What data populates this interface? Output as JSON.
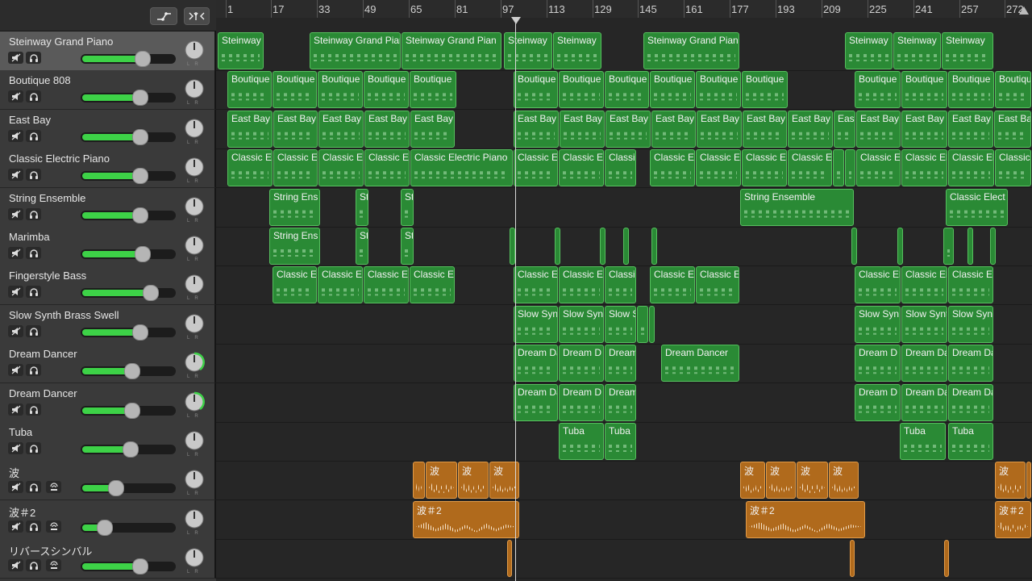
{
  "header": {
    "automation_icon": "automation-curve-icon",
    "filter_icon": "catch-filter-icon"
  },
  "ruler": {
    "bars": [
      "1",
      "17",
      "33",
      "49",
      "65",
      "81",
      "97",
      "113",
      "129",
      "145",
      "161",
      "177",
      "193",
      "209",
      "225",
      "241",
      "257",
      "272"
    ]
  },
  "colors": {
    "midi_region": "#2a8a35",
    "audio_region": "#b06a1c",
    "volume_meter": "#3dd247"
  },
  "tracks": [
    {
      "name": "Steinway Grand Piano",
      "selected": true,
      "volume": 0.75,
      "loop_button": false,
      "regions": [
        [
          "Steinway",
          2,
          60
        ],
        [
          "Steinway Grand Pian",
          116,
          230
        ],
        [
          "Steinway Grand Pian",
          230,
          355
        ],
        [
          "Steinway",
          357,
          418
        ],
        [
          "Steinway",
          418,
          479
        ],
        [
          "Steinway Grand Pian",
          530,
          650
        ],
        [
          "Steinway",
          780,
          840
        ],
        [
          "Steinway",
          840,
          900
        ],
        [
          "Steinway",
          900,
          965
        ]
      ]
    },
    {
      "name": "Boutique 808",
      "selected": false,
      "volume": 0.72,
      "loop_button": false,
      "regions": [
        [
          "Boutique",
          14,
          70
        ],
        [
          "Boutique",
          70,
          126
        ],
        [
          "Boutique",
          126,
          183
        ],
        [
          "Boutique",
          183,
          240
        ],
        [
          "Boutique",
          240,
          299
        ],
        [
          "Boutique",
          369,
          425
        ],
        [
          "Boutique",
          425,
          482
        ],
        [
          "Boutique",
          482,
          538
        ],
        [
          "Boutique",
          538,
          595
        ],
        [
          "Boutique",
          595,
          652
        ],
        [
          "Boutique",
          652,
          710
        ],
        [
          "Boutique",
          792,
          850
        ],
        [
          "Boutique",
          850,
          908
        ],
        [
          "Boutique",
          908,
          966
        ],
        [
          "Boutique",
          966,
          1012
        ]
      ]
    },
    {
      "name": "East Bay",
      "selected": false,
      "volume": 0.72,
      "loop_button": false,
      "regions": [
        [
          "East Bay",
          14,
          71
        ],
        [
          "East Bay",
          71,
          127
        ],
        [
          "East Bay",
          127,
          184
        ],
        [
          "East Bay",
          184,
          241
        ],
        [
          "East Bay",
          241,
          297
        ],
        [
          "East Bay",
          369,
          426
        ],
        [
          "East Bay",
          426,
          483
        ],
        [
          "East Bay",
          483,
          540
        ],
        [
          "East Bay",
          540,
          596
        ],
        [
          "East Bay",
          596,
          653
        ],
        [
          "East Bay",
          653,
          709
        ],
        [
          "East Bay",
          709,
          766
        ],
        [
          "East",
          766,
          794
        ],
        [
          "East Bay",
          794,
          850
        ],
        [
          "East Bay",
          850,
          908
        ],
        [
          "East Bay",
          908,
          965
        ],
        [
          "East Bay",
          965,
          1012
        ]
      ]
    },
    {
      "name": "Classic Electric Piano",
      "selected": false,
      "volume": 0.72,
      "loop_button": false,
      "regions": [
        [
          "Classic El",
          14,
          71
        ],
        [
          "Classic El",
          71,
          127
        ],
        [
          "Classic El",
          127,
          184
        ],
        [
          "Classic El",
          184,
          241
        ],
        [
          "Classic Electric Piano",
          241,
          369
        ],
        [
          "Classic El",
          369,
          425
        ],
        [
          "Classic El",
          425,
          482
        ],
        [
          "Classic",
          482,
          522
        ],
        [
          "Classic El",
          538,
          595
        ],
        [
          "Classic El",
          595,
          652
        ],
        [
          "Classic El",
          652,
          709
        ],
        [
          "Classic El",
          709,
          765
        ],
        [
          "",
          765,
          780
        ],
        [
          "",
          780,
          794
        ],
        [
          "Classic El",
          794,
          850
        ],
        [
          "Classic El",
          850,
          908
        ],
        [
          "Classic El",
          908,
          966
        ],
        [
          "Classic",
          966,
          1012
        ]
      ]
    },
    {
      "name": "String Ensemble",
      "selected": false,
      "volume": 0.72,
      "loop_button": false,
      "regions": [
        [
          "String Ens",
          66,
          130
        ],
        [
          "St",
          173,
          190
        ],
        [
          "St",
          229,
          246
        ],
        [
          "String Ensemble",
          650,
          792
        ],
        [
          "Classic Elect",
          905,
          983
        ]
      ]
    },
    {
      "name": "Marimba",
      "selected": false,
      "volume": 0.75,
      "loop_button": false,
      "regions": [
        [
          "String Ens",
          66,
          130
        ],
        [
          "St",
          173,
          190
        ],
        [
          "St",
          229,
          246
        ],
        [
          "",
          364,
          372
        ],
        [
          "",
          420,
          428
        ],
        [
          "",
          476,
          484
        ],
        [
          "",
          505,
          513
        ],
        [
          "",
          540,
          548
        ],
        [
          "",
          788,
          796
        ],
        [
          "",
          845,
          853
        ],
        [
          "",
          902,
          916
        ],
        [
          "",
          932,
          940
        ],
        [
          "",
          960,
          968
        ]
      ]
    },
    {
      "name": "Fingerstyle Bass",
      "selected": false,
      "volume": 0.85,
      "loop_button": false,
      "regions": [
        [
          "Classic El",
          70,
          126
        ],
        [
          "Classic El",
          126,
          183
        ],
        [
          "Classic El",
          183,
          240
        ],
        [
          "Classic El",
          240,
          297
        ],
        [
          "Classic El",
          369,
          425
        ],
        [
          "Classic El",
          425,
          482
        ],
        [
          "Classi",
          482,
          522
        ],
        [
          "Classic El",
          538,
          595
        ],
        [
          "Classic El",
          595,
          650
        ],
        [
          "Classic El",
          792,
          850
        ],
        [
          "Classic El",
          850,
          908
        ],
        [
          "Classic El",
          908,
          965
        ]
      ]
    },
    {
      "name": "Slow Synth Brass Swell",
      "selected": false,
      "volume": 0.72,
      "loop_button": false,
      "regions": [
        [
          "Slow Synt",
          369,
          425
        ],
        [
          "Slow Syn",
          425,
          482
        ],
        [
          "Slow S",
          482,
          522
        ],
        [
          "",
          522,
          537
        ],
        [
          "",
          537,
          545
        ],
        [
          "Slow Syn",
          792,
          850
        ],
        [
          "Slow Synt",
          850,
          908
        ],
        [
          "Slow Synt",
          908,
          965
        ]
      ]
    },
    {
      "name": "Dream Dancer",
      "selected": false,
      "volume": 0.62,
      "loop_button": false,
      "regions": [
        [
          "Dream Da",
          369,
          425
        ],
        [
          "Dream D",
          425,
          482
        ],
        [
          "Dream",
          482,
          522
        ],
        [
          "Dream Dancer",
          552,
          650
        ],
        [
          "Dream D",
          792,
          850
        ],
        [
          "Dream Da",
          850,
          908
        ],
        [
          "Dream Da",
          908,
          965
        ]
      ]
    },
    {
      "name": "Dream Dancer",
      "selected": false,
      "volume": 0.62,
      "loop_button": false,
      "regions": [
        [
          "Dream Da",
          369,
          425
        ],
        [
          "Dream D",
          425,
          482
        ],
        [
          "Dream",
          482,
          522
        ],
        [
          "Dream D",
          792,
          850
        ],
        [
          "Dream Da",
          850,
          908
        ],
        [
          "Dream Da",
          908,
          965
        ]
      ]
    },
    {
      "name": "Tuba",
      "selected": false,
      "volume": 0.6,
      "loop_button": false,
      "regions": [
        [
          "Tuba",
          425,
          482
        ],
        [
          "Tuba",
          482,
          522
        ],
        [
          "Tuba",
          848,
          906
        ],
        [
          "Tuba",
          908,
          965
        ]
      ]
    },
    {
      "name": "波",
      "selected": false,
      "volume": 0.42,
      "loop_button": true,
      "audio": true,
      "regions": [
        [
          "",
          244,
          260
        ],
        [
          "波",
          260,
          300
        ],
        [
          "波",
          300,
          339
        ],
        [
          "波",
          339,
          377
        ],
        [
          "波",
          650,
          682
        ],
        [
          "波",
          682,
          720
        ],
        [
          "波",
          720,
          760
        ],
        [
          "波",
          760,
          798
        ],
        [
          "波",
          966,
          1005
        ],
        [
          "波",
          1005,
          1012
        ]
      ]
    },
    {
      "name": "波＃2",
      "selected": false,
      "volume": 0.28,
      "loop_button": true,
      "audio": true,
      "regions": [
        [
          "波＃2",
          244,
          377
        ],
        [
          "波＃2",
          657,
          806
        ],
        [
          "波＃2",
          966,
          1012
        ]
      ]
    },
    {
      "name": "リバースシンバル",
      "selected": false,
      "volume": 0.72,
      "loop_button": true,
      "audio": true,
      "regions": [
        [
          "",
          361,
          368
        ],
        [
          "",
          786,
          793
        ],
        [
          "",
          903,
          909
        ]
      ]
    }
  ]
}
